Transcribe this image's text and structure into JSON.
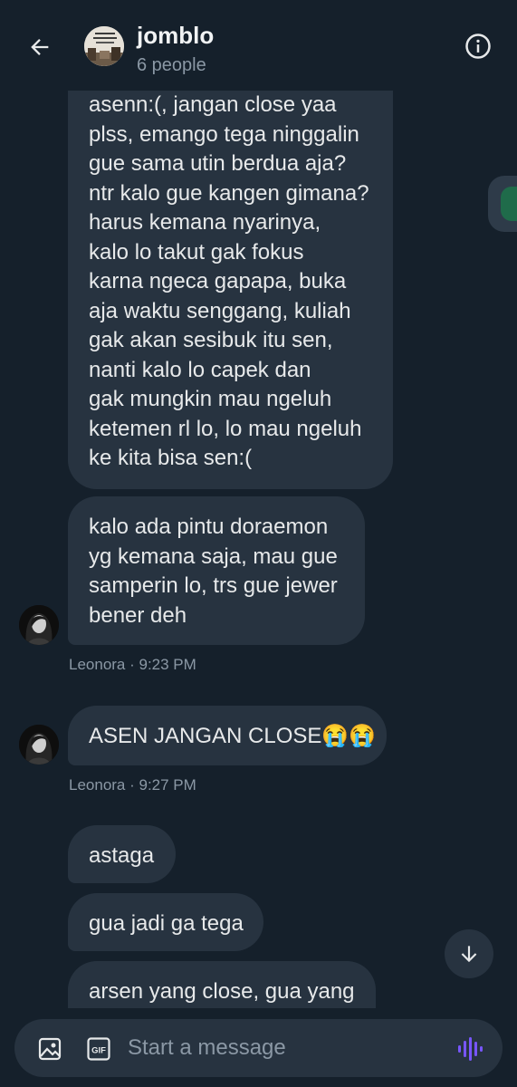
{
  "header": {
    "title": "jomblo",
    "subtitle": "6 people",
    "icons": {
      "back": "arrow-left-icon",
      "info": "info-icon"
    }
  },
  "messages": [
    {
      "lines": [
        "asenn:(, jangan close yaa",
        "plss, emango tega ninggalin",
        "gue sama utin berdua aja?",
        "ntr kalo gue kangen gimana?",
        "harus kemana nyarinya,",
        "kalo lo takut gak fokus",
        "karna ngeca gapapa, buka",
        "aja waktu senggang, kuliah",
        "gak akan sesibuk itu sen,",
        "nanti kalo lo capek dan",
        "gak mungkin mau ngeluh",
        "ketemen rl lo, lo mau ngeluh",
        "ke kita bisa sen:("
      ]
    },
    {
      "lines": [
        "kalo ada pintu doraemon",
        "yg kemana saja, mau gue",
        "samperin lo, trs gue jewer",
        "bener deh"
      ],
      "sender": "Leonora",
      "time": "9:23 PM",
      "meta": "Leonora · 9:23 PM"
    },
    {
      "text": "ASEN JANGAN CLOSE😭😭",
      "sender": "Leonora",
      "time": "9:27 PM",
      "meta": "Leonora · 9:27 PM"
    },
    {
      "text": "astaga"
    },
    {
      "text": "gua jadi ga tega"
    },
    {
      "text": "arsen yang close, gua yang"
    }
  ],
  "composer": {
    "placeholder": "Start a message",
    "icons": {
      "image": "image-icon",
      "gif": "gif-icon",
      "voice": "voice-message-icon"
    }
  },
  "colors": {
    "background": "#15202b",
    "bubble": "#273340",
    "text": "#e7e9ea",
    "secondary_text": "#8b98a5",
    "accent": "#7856ff"
  }
}
